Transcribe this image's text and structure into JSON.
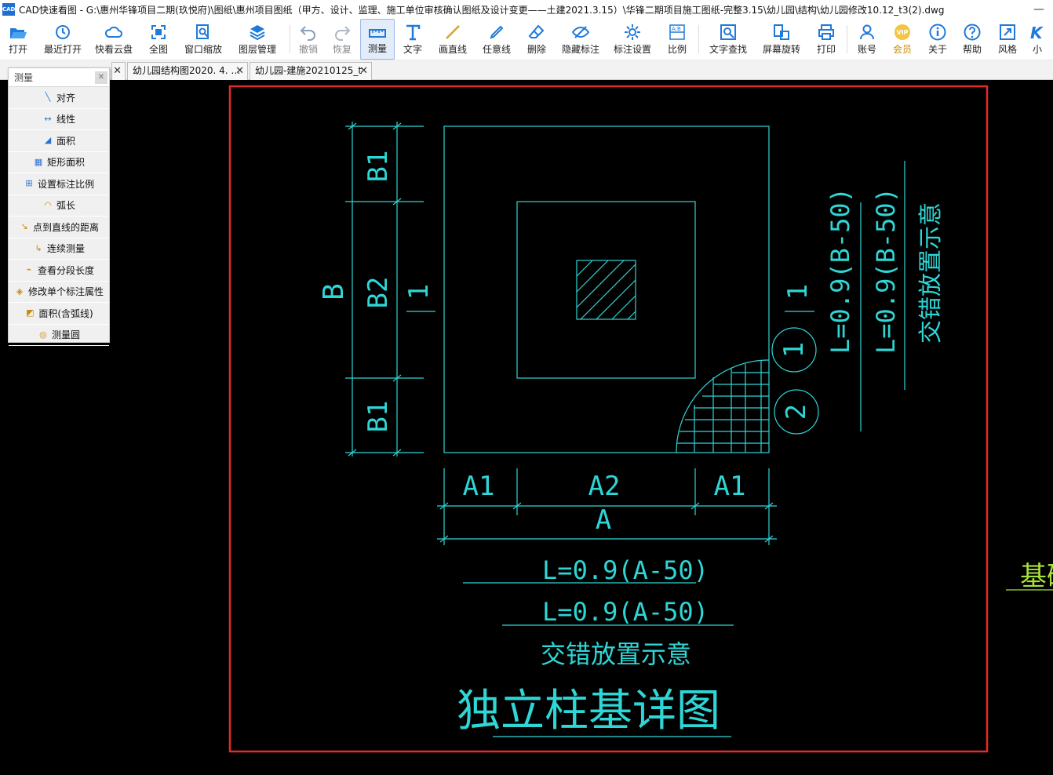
{
  "window": {
    "title": "CAD快速看图 - G:\\惠州华锋项目二期(玖悦府)\\图纸\\惠州项目图纸（甲方、设计、监理、施工单位审核确认图纸及设计变更——土建2021.3.15）\\华锋二期项目施工图纸-完整3.15\\幼儿园\\结构\\幼儿园修改10.12_t3(2).dwg",
    "logo_text": "CAD",
    "minimize": "—"
  },
  "toolbar": [
    {
      "label": "打开",
      "icon": "folder-open-icon"
    },
    {
      "label": "最近打开",
      "icon": "history-icon"
    },
    {
      "label": "快看云盘",
      "icon": "cloud-icon"
    },
    {
      "label": "全图",
      "icon": "fullscreen-icon"
    },
    {
      "label": "窗口缩放",
      "icon": "zoom-window-icon"
    },
    {
      "label": "图层管理",
      "icon": "layers-icon"
    },
    {
      "label": "撤销",
      "icon": "undo-icon"
    },
    {
      "label": "恢复",
      "icon": "redo-icon"
    },
    {
      "label": "测量",
      "icon": "ruler-icon"
    },
    {
      "label": "文字",
      "icon": "text-icon"
    },
    {
      "label": "画直线",
      "icon": "line-icon"
    },
    {
      "label": "任意线",
      "icon": "pen-icon"
    },
    {
      "label": "删除",
      "icon": "eraser-icon"
    },
    {
      "label": "隐藏标注",
      "icon": "eye-off-icon"
    },
    {
      "label": "标注设置",
      "icon": "settings-icon"
    },
    {
      "label": "比例",
      "icon": "scale-icon"
    },
    {
      "label": "文字查找",
      "icon": "text-search-icon"
    },
    {
      "label": "屏幕旋转",
      "icon": "rotate-icon"
    },
    {
      "label": "打印",
      "icon": "printer-icon"
    },
    {
      "label": "账号",
      "icon": "user-icon"
    },
    {
      "label": "会员",
      "icon": "vip-icon"
    },
    {
      "label": "关于",
      "icon": "info-icon"
    },
    {
      "label": "帮助",
      "icon": "help-icon"
    },
    {
      "label": "风格",
      "icon": "style-icon"
    },
    {
      "label": "小",
      "icon": "k-icon"
    }
  ],
  "tabs": [
    {
      "label": "幼儿园结构图2020. 4. …",
      "close": "✕"
    },
    {
      "label": "幼儿园-建施20210125_t",
      "close": "✕"
    }
  ],
  "measure_panel": {
    "title": "测量",
    "close": "✕",
    "items": [
      {
        "label": "对齐",
        "icon": "align-measure-icon"
      },
      {
        "label": "线性",
        "icon": "linear-measure-icon"
      },
      {
        "label": "面积",
        "icon": "area-icon"
      },
      {
        "label": "矩形面积",
        "icon": "rect-area-icon"
      },
      {
        "label": "设置标注比例",
        "icon": "scale-setting-icon"
      },
      {
        "label": "弧长",
        "icon": "arc-length-icon"
      },
      {
        "label": "点到直线的距离",
        "icon": "point-line-distance-icon"
      },
      {
        "label": "连续测量",
        "icon": "continuous-measure-icon"
      },
      {
        "label": "查看分段长度",
        "icon": "segment-length-icon"
      },
      {
        "label": "修改单个标注属性",
        "icon": "edit-annotation-icon"
      },
      {
        "label": "面积(含弧线)",
        "icon": "arc-area-icon"
      },
      {
        "label": "测量圆",
        "icon": "circle-measure-icon"
      }
    ]
  },
  "drawing": {
    "dim_b1_top": "B1",
    "dim_b2": "B2",
    "dim_b1_bottom": "B1",
    "dim_b": "B",
    "section_left": "1",
    "section_right": "1",
    "bubble_1": "1",
    "bubble_2": "2",
    "dim_a1_left": "A1",
    "dim_a2": "A2",
    "dim_a1_right": "A1",
    "dim_a": "A",
    "note_a_1": "L=0.9(A-50)",
    "note_a_2": "L=0.9(A-50)",
    "note_stagger": "交错放置示意",
    "note_b_1": "L=0.9(B-50)",
    "note_b_2": "L=0.9(B-50)",
    "note_stagger_b": "交错放置示意",
    "title": "独立柱基详图",
    "side_label": "基础"
  },
  "colors": {
    "cad_line": "#2fd6d6",
    "highlight": "#e22b2b",
    "side_text": "#a8e03a",
    "vip": "#c98a0a"
  }
}
